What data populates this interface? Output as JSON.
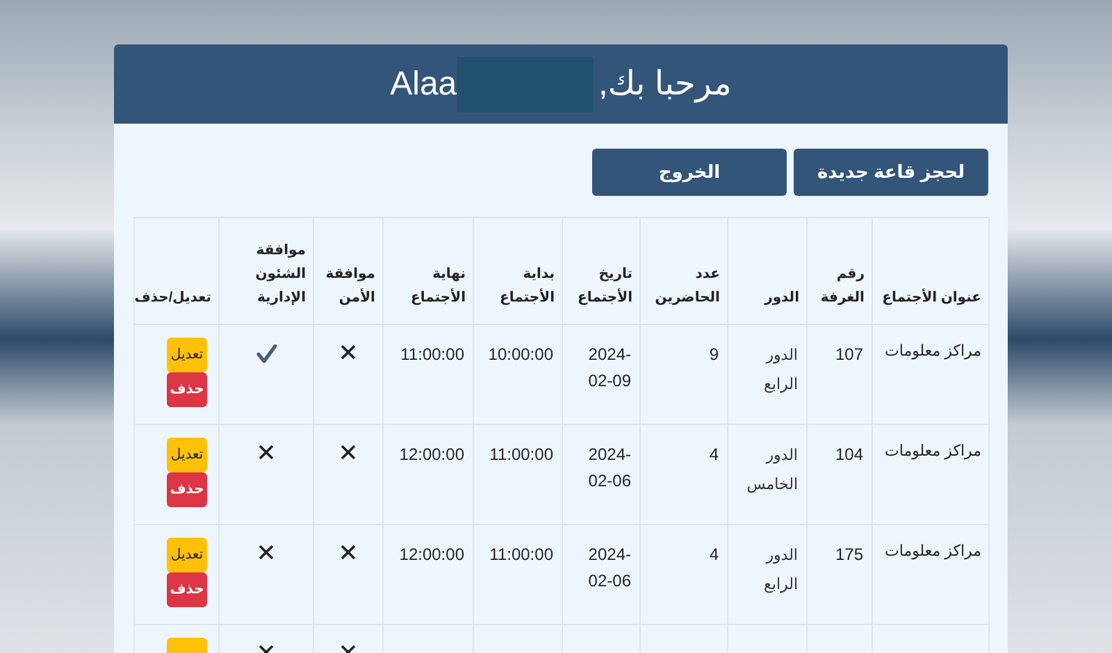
{
  "header": {
    "greeting": "مرحبا بك,",
    "name": "Alaa"
  },
  "buttons": [
    {
      "kind": "primary",
      "label": "لحجز قاعة جديدة"
    },
    {
      "kind": "primary",
      "label": "الخروج"
    }
  ],
  "table": {
    "columns": [
      "عنوان الأجتماع",
      "رقم الغرفة",
      "الدور",
      "عدد الحاضرين",
      "تاريخ الأجتماع",
      "بداية الأجتماع",
      "نهاية الأجتماع",
      "موافقة الأمن",
      "موافقة الشئون الإدارية",
      "تعديل/حذف"
    ],
    "rows": [
      {
        "title": "مراكز معلومات",
        "room": "107",
        "floor": "الدور الرابع",
        "attendees": "9",
        "date": "2024-02-09",
        "start": "10:00:00",
        "end": "11:00:00",
        "security_approved": false,
        "admin_approved": true,
        "actions": [
          {
            "kind": "edit",
            "label": "تعديل"
          },
          {
            "kind": "delete",
            "label": "حذف"
          }
        ]
      },
      {
        "title": "مراكز معلومات",
        "room": "104",
        "floor": "الدور الخامس",
        "attendees": "4",
        "date": "2024-02-06",
        "start": "11:00:00",
        "end": "12:00:00",
        "security_approved": false,
        "admin_approved": false,
        "actions": [
          {
            "kind": "edit",
            "label": "تعديل"
          },
          {
            "kind": "delete",
            "label": "حذف"
          }
        ]
      },
      {
        "title": "مراكز معلومات",
        "room": "175",
        "floor": "الدور الرابع",
        "attendees": "4",
        "date": "2024-02-06",
        "start": "11:00:00",
        "end": "12:00:00",
        "security_approved": false,
        "admin_approved": false,
        "actions": [
          {
            "kind": "edit",
            "label": "تعديل"
          },
          {
            "kind": "delete",
            "label": "حذف"
          }
        ]
      },
      {
        "security_approved": false,
        "admin_approved": false,
        "actions": [
          {
            "kind": "edit"
          }
        ]
      }
    ]
  }
}
